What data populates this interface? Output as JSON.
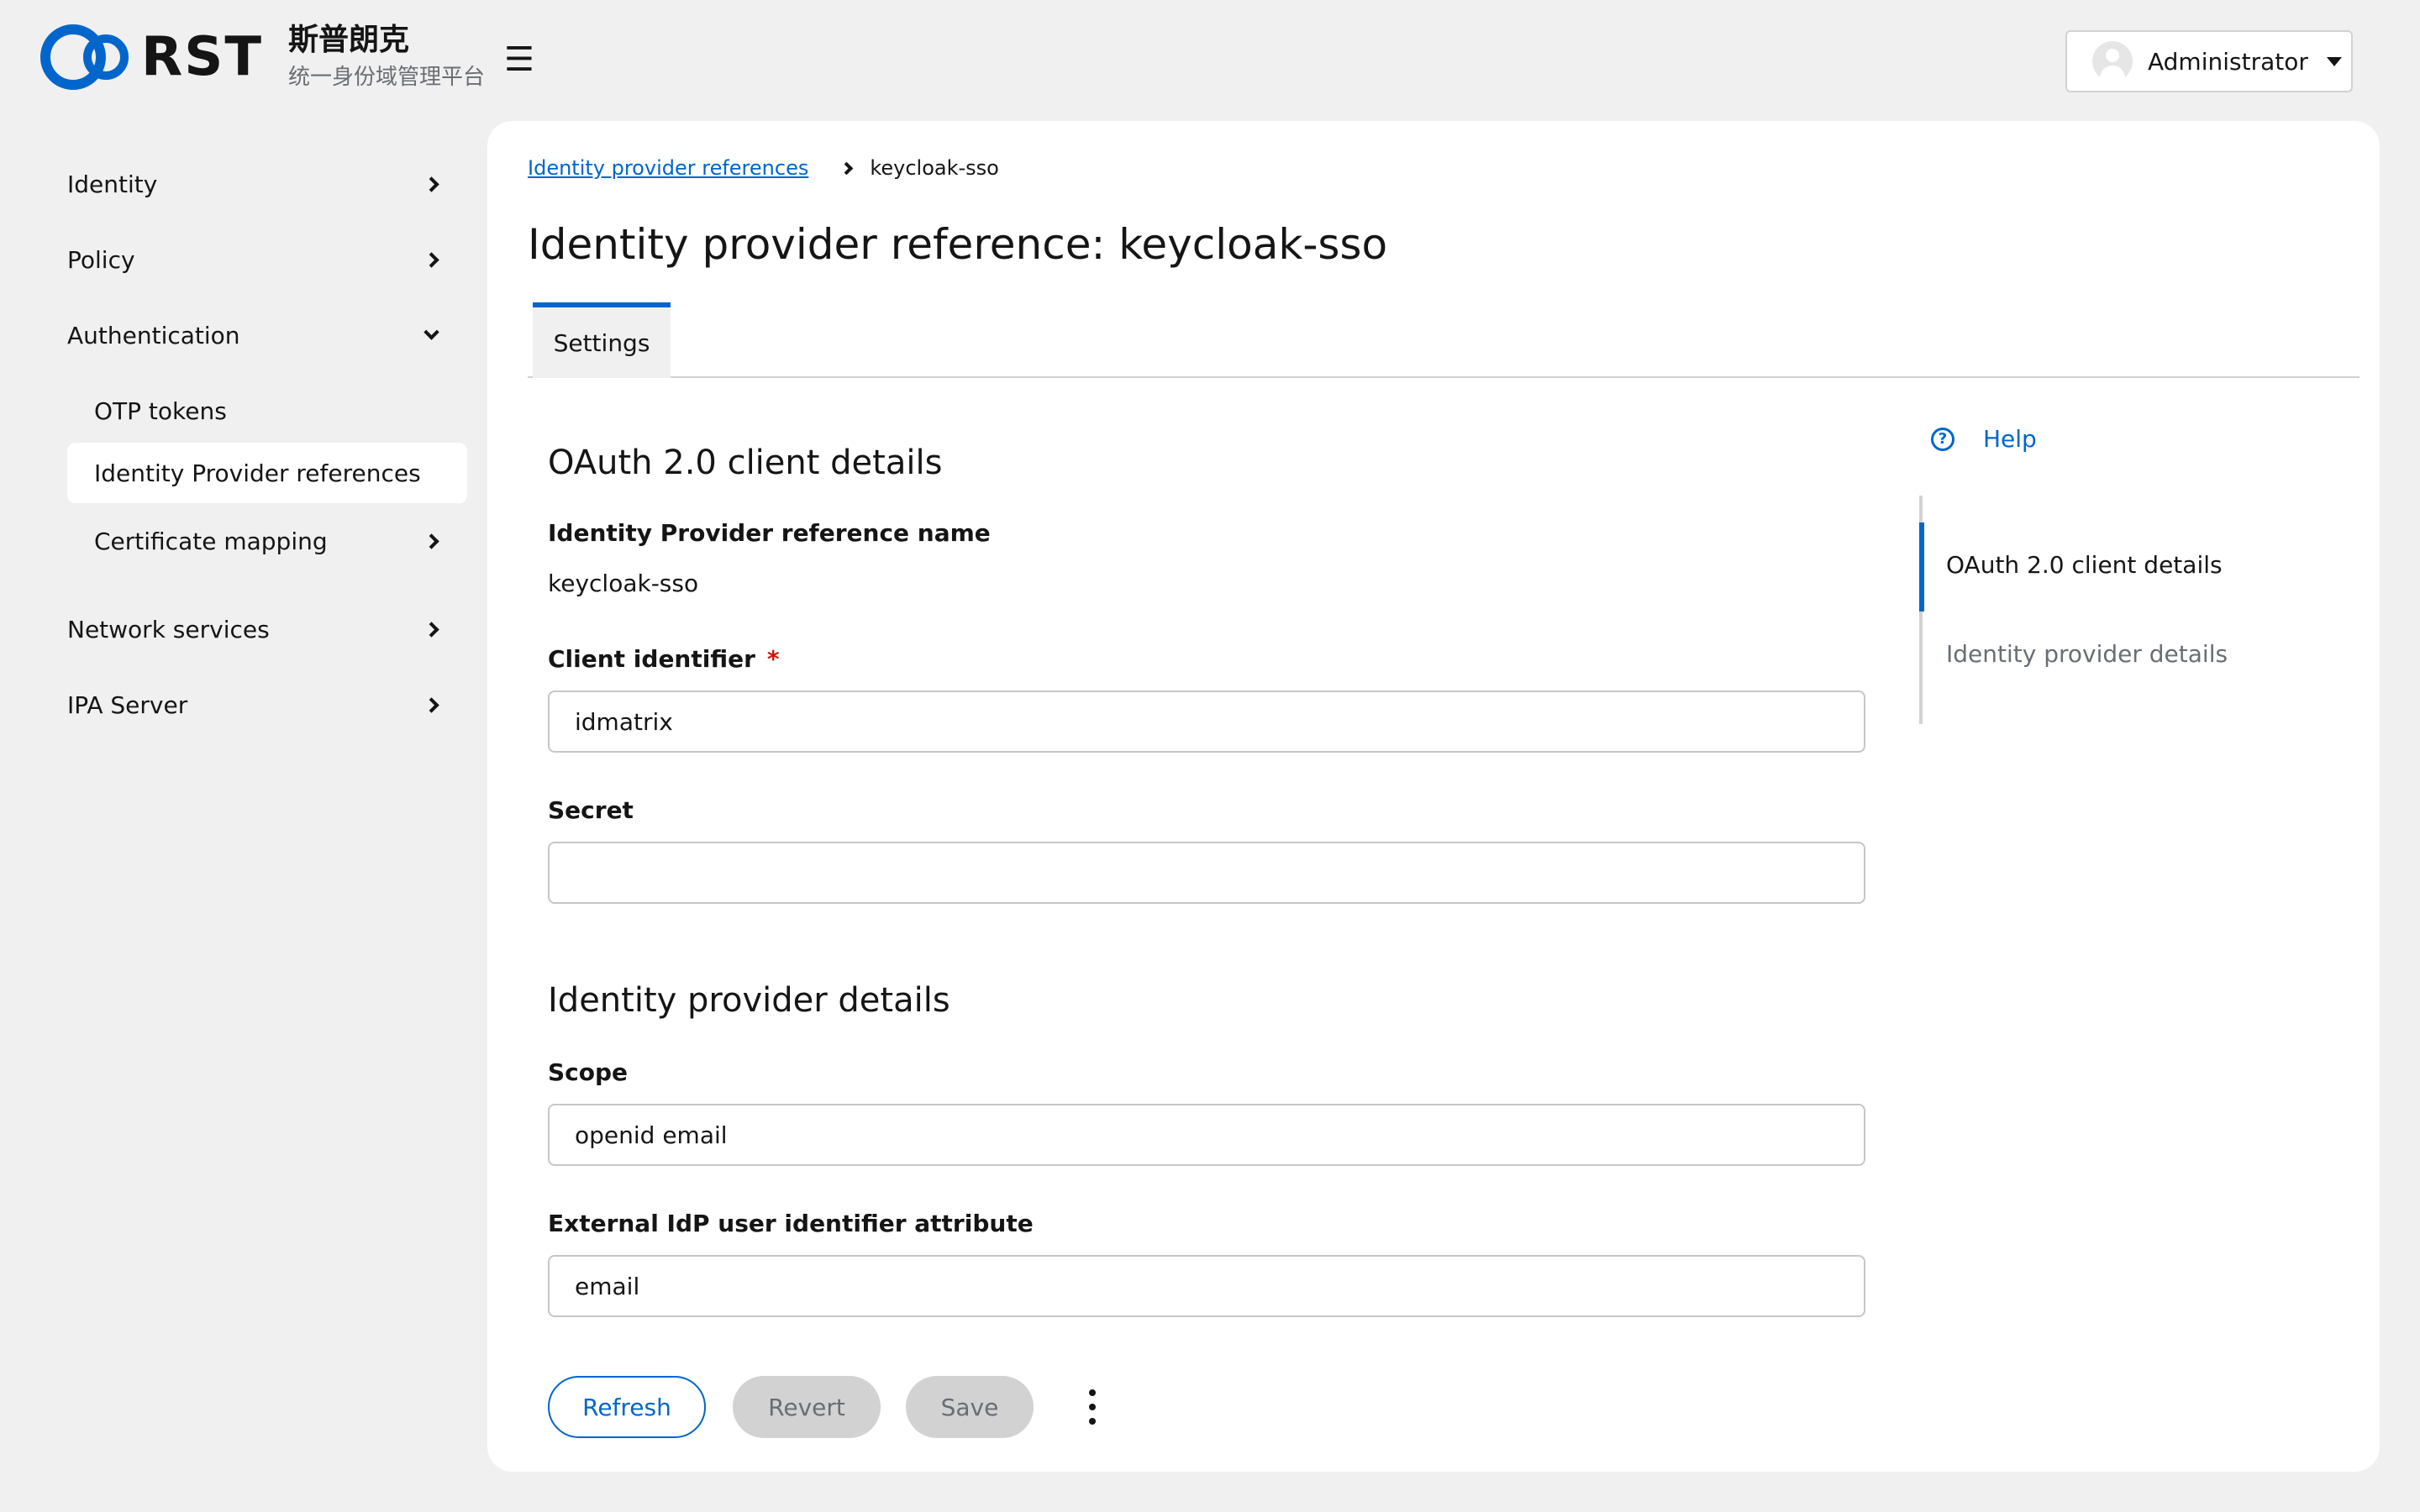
{
  "brand": {
    "logo_text": "RST",
    "title_cn": "斯普朗克",
    "subtitle_cn": "统一身份域管理平台",
    "primary_color": "#0066cc"
  },
  "header": {
    "menu_icon": "hamburger-icon",
    "user_name": "Administrator"
  },
  "sidebar": {
    "items": [
      {
        "label": "Identity"
      },
      {
        "label": "Policy"
      },
      {
        "label": "Authentication"
      },
      {
        "label": "OTP tokens"
      },
      {
        "label": "Identity Provider references"
      },
      {
        "label": "Certificate mapping"
      },
      {
        "label": "Network services"
      },
      {
        "label": "IPA Server"
      }
    ]
  },
  "breadcrumb": {
    "parent": "Identity provider references",
    "current": "keycloak-sso"
  },
  "page_title": "Identity provider reference: keycloak-sso",
  "tabs": [
    {
      "label": "Settings"
    }
  ],
  "sections": {
    "oauth": {
      "title": "OAuth 2.0 client details",
      "name_label": "Identity Provider reference name",
      "name_value": "keycloak-sso",
      "client_id_label": "Client identifier",
      "required_mark": "*",
      "client_id_value": "idmatrix",
      "secret_label": "Secret",
      "secret_value": ""
    },
    "idp": {
      "title": "Identity provider details",
      "scope_label": "Scope",
      "scope_value": "openid email",
      "ext_attr_label": "External IdP user identifier attribute",
      "ext_attr_value": "email"
    }
  },
  "help": {
    "label": "Help",
    "icon_text": "?"
  },
  "jump_links": [
    {
      "label": "OAuth 2.0 client details"
    },
    {
      "label": "Identity provider details"
    }
  ],
  "actions": {
    "refresh": "Refresh",
    "revert": "Revert",
    "save": "Save"
  }
}
